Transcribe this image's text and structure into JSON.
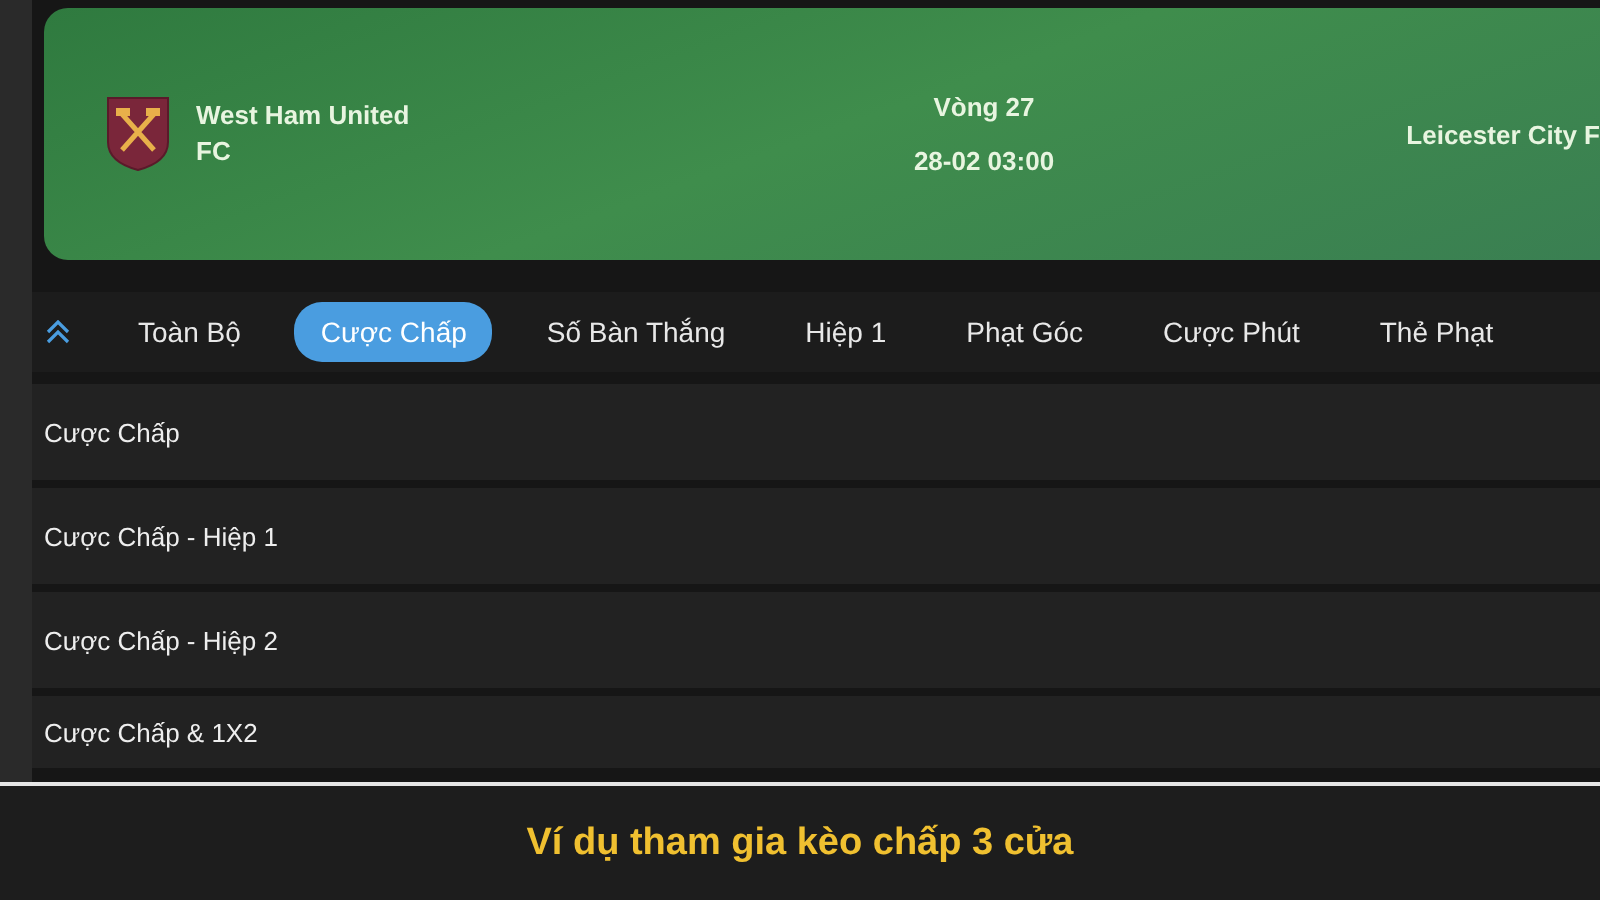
{
  "match": {
    "home_team": "West Ham United FC",
    "round": "Vòng 27",
    "datetime": "28-02 03:00",
    "away_team": "Leicester City F"
  },
  "tabs": [
    {
      "label": "Toàn Bộ",
      "selected": false
    },
    {
      "label": "Cược Chấp",
      "selected": true
    },
    {
      "label": "Số Bàn Thắng",
      "selected": false
    },
    {
      "label": "Hiệp 1",
      "selected": false
    },
    {
      "label": "Phạt Góc",
      "selected": false
    },
    {
      "label": "Cược Phút",
      "selected": false
    },
    {
      "label": "Thẻ Phạt",
      "selected": false
    }
  ],
  "markets": [
    {
      "label": "Cược Chấp"
    },
    {
      "label": "Cược Chấp - Hiệp 1"
    },
    {
      "label": "Cược Chấp - Hiệp 2"
    },
    {
      "label": "Cược Chấp & 1X2"
    }
  ],
  "caption": "Ví dụ tham gia kèo chấp 3 cửa"
}
